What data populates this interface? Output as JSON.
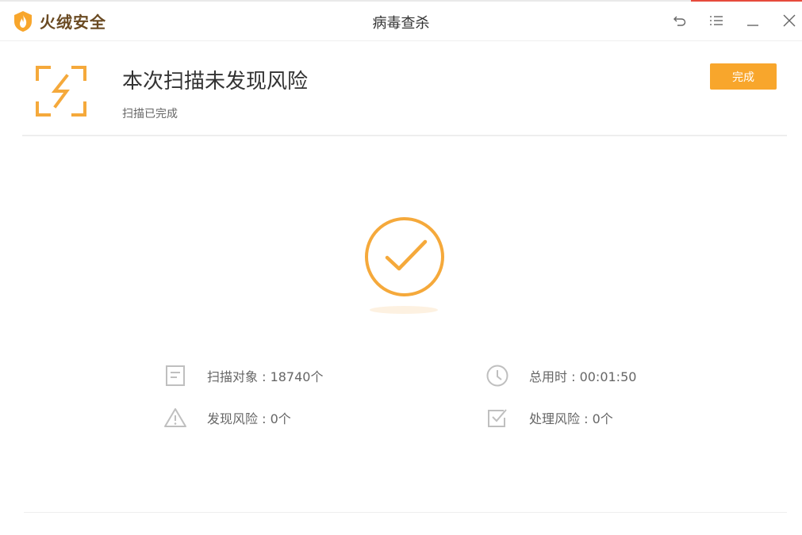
{
  "app": {
    "brand": "火绒安全",
    "window_title": "病毒查杀"
  },
  "window_controls": [
    "back-icon",
    "menu-icon",
    "minimize-icon",
    "close-icon"
  ],
  "header": {
    "title": "本次扫描未发现风险",
    "subtitle": "扫描已完成",
    "done_label": "完成"
  },
  "stats": {
    "scanned_objects": "扫描对象 : 18740个",
    "elapsed_time": "总用时 : 00:01:50",
    "risks_found": "发现风险 : 0个",
    "risks_handled": "处理风险 : 0个"
  },
  "colors": {
    "accent": "#f8a62c",
    "icon_orange": "#f5a93b",
    "brand_text": "#6a4a22",
    "stat_icon": "#bfbfbf",
    "title_border_red": "#e64b3c"
  }
}
